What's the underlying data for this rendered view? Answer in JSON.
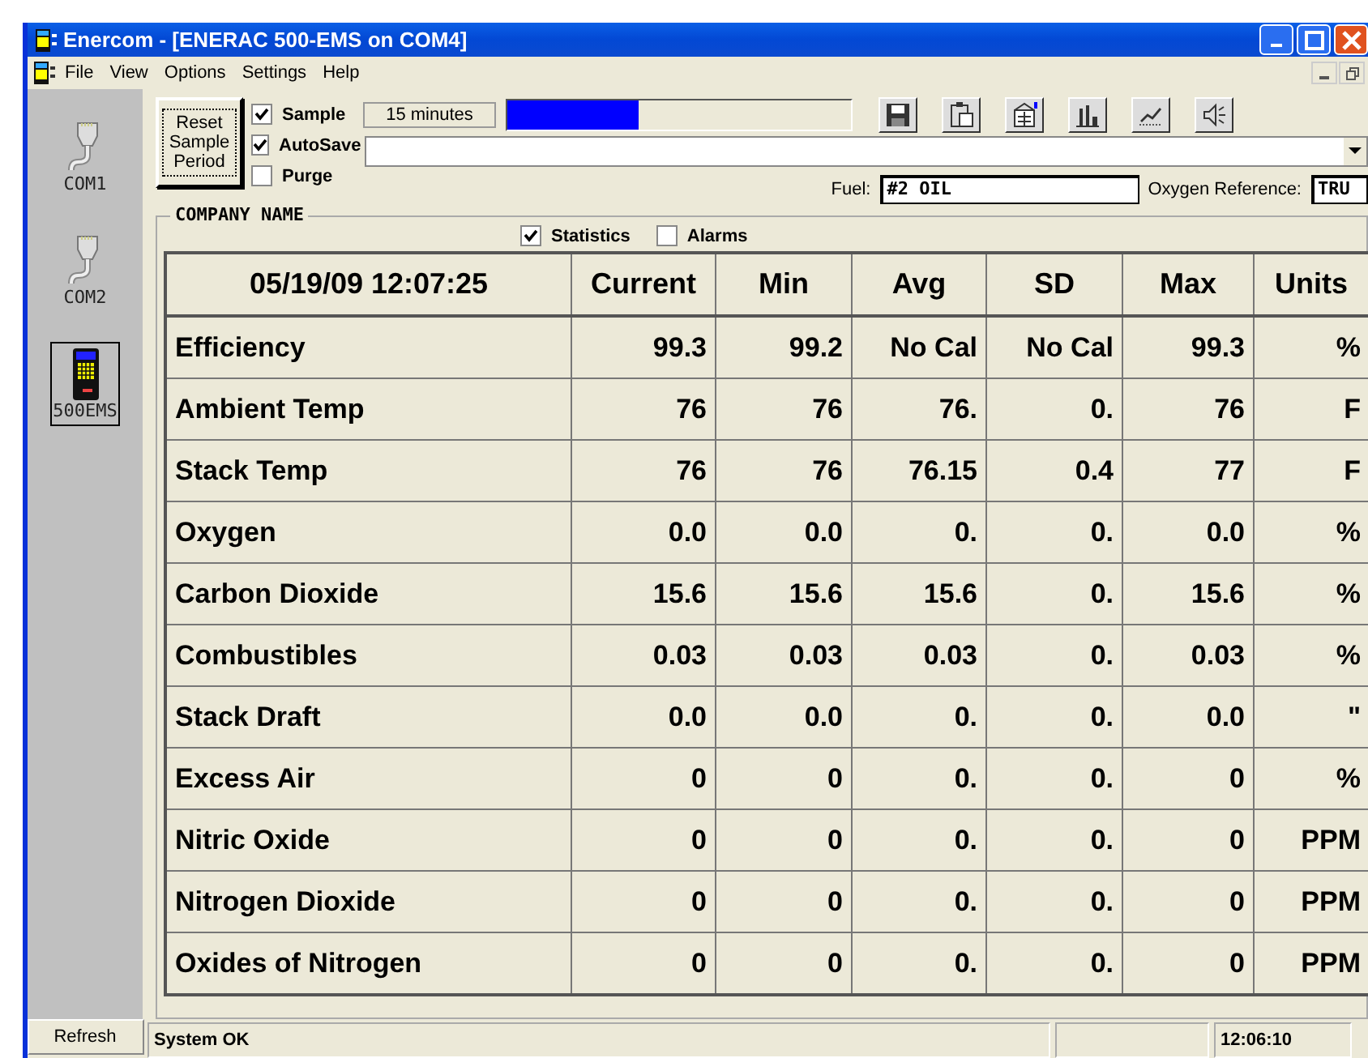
{
  "window": {
    "title": "Enercom - [ENERAC 500-EMS on COM4]"
  },
  "menu": [
    "File",
    "View",
    "Options",
    "Settings",
    "Help"
  ],
  "sidebar": {
    "items": [
      {
        "label": "COM1",
        "kind": "port",
        "selected": false
      },
      {
        "label": "COM2",
        "kind": "port",
        "selected": false
      },
      {
        "label": "500EMS",
        "kind": "device",
        "selected": true
      }
    ],
    "refresh": "Refresh"
  },
  "controls": {
    "reset_button": "Reset Sample Period",
    "checkboxes": [
      {
        "label": "Sample",
        "checked": true
      },
      {
        "label": "AutoSave",
        "checked": true
      },
      {
        "label": "Purge",
        "checked": false
      }
    ],
    "period_button": "15 minutes",
    "progress": {
      "level": 0.38
    },
    "tools": [
      {
        "kind": "save"
      },
      {
        "kind": "clipboard"
      },
      {
        "kind": "form"
      },
      {
        "kind": "bars"
      },
      {
        "kind": "line"
      },
      {
        "kind": "speaker"
      }
    ],
    "fuel": {
      "label": "Fuel:",
      "value": "#2 OIL"
    },
    "oxygen_reference": {
      "label": "Oxygen Reference:",
      "value": "TRU"
    }
  },
  "group": {
    "title": "COMPANY NAME",
    "options": [
      {
        "label": "Statistics",
        "checked": true
      },
      {
        "label": "Alarms",
        "checked": false
      }
    ]
  },
  "table": {
    "columns": [
      "05/19/09 12:07:25",
      "Current",
      "Min",
      "Avg",
      "SD",
      "Max",
      "Units"
    ],
    "rows": [
      [
        "Efficiency",
        "99.3",
        "99.2",
        "No Cal",
        "No Cal",
        "99.3",
        "%"
      ],
      [
        "Ambient Temp",
        "76",
        "76",
        "76.",
        "0.",
        "76",
        "F"
      ],
      [
        "Stack Temp",
        "76",
        "76",
        "76.15",
        "0.4",
        "77",
        "F"
      ],
      [
        "Oxygen",
        "0.0",
        "0.0",
        "0.",
        "0.",
        "0.0",
        "%"
      ],
      [
        "Carbon Dioxide",
        "15.6",
        "15.6",
        "15.6",
        "0.",
        "15.6",
        "%"
      ],
      [
        "Combustibles",
        "0.03",
        "0.03",
        "0.03",
        "0.",
        "0.03",
        "%"
      ],
      [
        "Stack Draft",
        "0.0",
        "0.0",
        "0.",
        "0.",
        "0.0",
        "\""
      ],
      [
        "Excess Air",
        "0",
        "0",
        "0.",
        "0.",
        "0",
        "%"
      ],
      [
        "Nitric Oxide",
        "0",
        "0",
        "0.",
        "0.",
        "0",
        "PPM"
      ],
      [
        "Nitrogen Dioxide",
        "0",
        "0",
        "0.",
        "0.",
        "0",
        "PPM"
      ],
      [
        "Oxides of Nitrogen",
        "0",
        "0",
        "0.",
        "0.",
        "0",
        "PPM"
      ]
    ]
  },
  "status_bar": {
    "message": "System OK",
    "time": "12:06:10"
  }
}
